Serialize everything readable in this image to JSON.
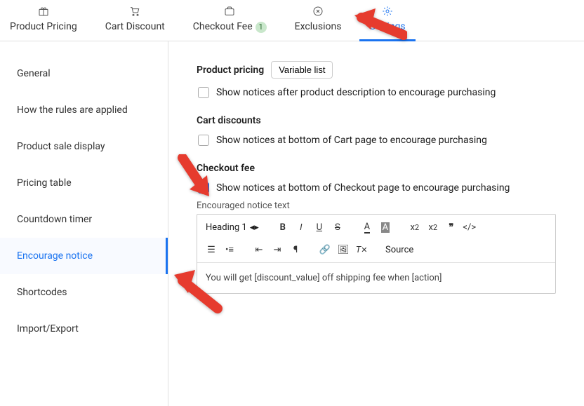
{
  "topnav": [
    {
      "label": "Product Pricing",
      "icon_name": "gift-icon"
    },
    {
      "label": "Cart Discount",
      "icon_name": "cart-icon"
    },
    {
      "label": "Checkout Fee",
      "icon_name": "briefcase-icon",
      "badge": "1"
    },
    {
      "label": "Exclusions",
      "icon_name": "close-circle-icon"
    },
    {
      "label": "Settings",
      "icon_name": "gear-icon",
      "active": true
    }
  ],
  "sidebar": [
    {
      "label": "General"
    },
    {
      "label": "How the rules are applied"
    },
    {
      "label": "Product sale display"
    },
    {
      "label": "Pricing table"
    },
    {
      "label": "Countdown timer"
    },
    {
      "label": "Encourage notice",
      "active": true
    },
    {
      "label": "Shortcodes"
    },
    {
      "label": "Import/Export"
    }
  ],
  "sections": {
    "product_pricing": {
      "title": "Product pricing",
      "variable_btn": "Variable list",
      "checkbox_label": "Show notices after product description to encourage purchasing",
      "checked": false
    },
    "cart_discounts": {
      "title": "Cart discounts",
      "checkbox_label": "Show notices at bottom of Cart page to encourage purchasing",
      "checked": false
    },
    "checkout_fee": {
      "title": "Checkout fee",
      "checkbox_label": "Show notices at bottom of Checkout page to encourage purchasing",
      "checked": true,
      "editor_label": "Encouraged notice text",
      "editor_content": "You will get [discount_value] off shipping fee when [action]"
    }
  },
  "editor_toolbar": {
    "heading_select": "Heading 1",
    "source_btn": "Source"
  }
}
